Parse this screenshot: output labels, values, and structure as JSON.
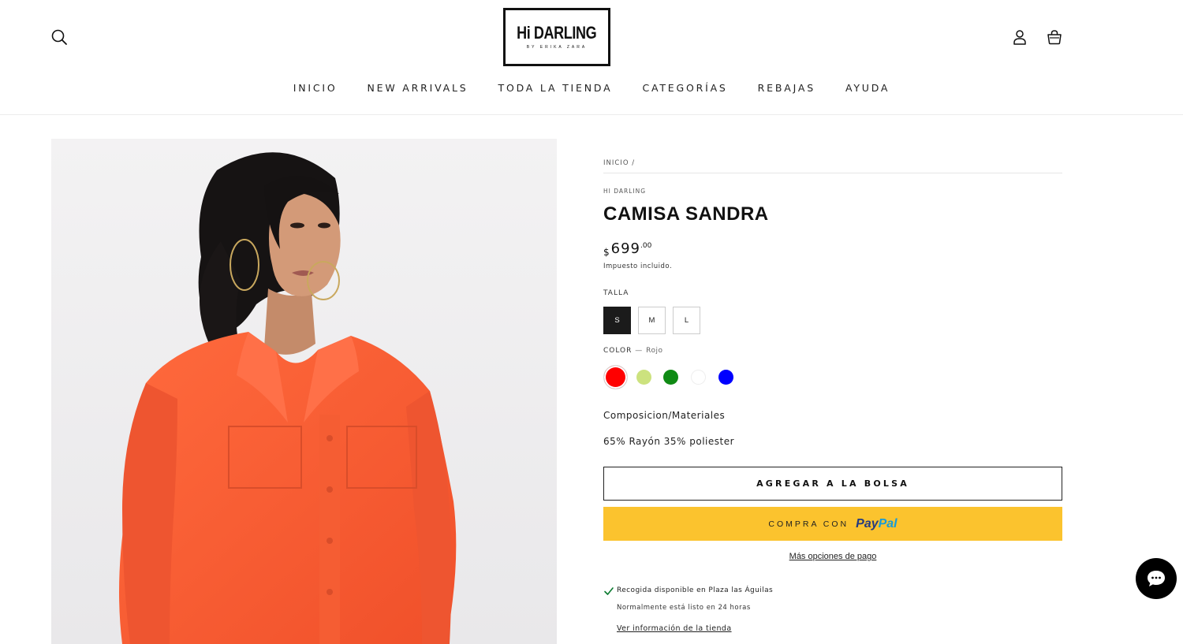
{
  "header": {
    "logo": {
      "main": "Hi DARLING",
      "sub": "BY ERIKA ZARA"
    },
    "icons": {
      "search": "search-icon",
      "account": "user-icon",
      "bag": "shopping-bag-icon"
    }
  },
  "nav": {
    "items": [
      "INICIO",
      "NEW ARRIVALS",
      "TODA LA TIENDA",
      "CATEGORÍAS",
      "REBAJAS",
      "AYUDA"
    ]
  },
  "product": {
    "breadcrumb": {
      "home": "INICIO",
      "separator": "/"
    },
    "vendor": "HI DARLING",
    "title": "CAMISA SANDRA",
    "price": {
      "currency": "$",
      "integer": "699",
      "decimals": ".00"
    },
    "tax_note": "Impuesto incluido.",
    "size": {
      "label": "TALLA",
      "options": [
        "S",
        "M",
        "L"
      ],
      "selected": "S"
    },
    "color": {
      "label": "COLOR",
      "separator": "—",
      "selected": "Rojo",
      "swatches": [
        {
          "name": "Rojo",
          "hex": "#ff0000"
        },
        {
          "name": "Verde claro",
          "hex": "#cce27e"
        },
        {
          "name": "Verde",
          "hex": "#0f8a14"
        },
        {
          "name": "Blanco",
          "hex": "#ffffff"
        },
        {
          "name": "Azul",
          "hex": "#0000ff"
        }
      ]
    },
    "composition_title": "Composicion/Materiales",
    "composition_value": "65% Rayón 35% poliester",
    "add_to_bag": "AGREGAR A LA BOLSA",
    "paypal": {
      "prefix": "COMPRA CON",
      "brand_a": "Pay",
      "brand_b": "Pal",
      "color": "#fbc32e"
    },
    "more_payment": "Más opciones de pago",
    "pickup": {
      "available": "Recogida disponible en Plaza las Águilas",
      "ready": "Normalmente está listo en 24 horas",
      "store_link": "Ver información de la tienda"
    }
  },
  "chat": {
    "icon": "chat-icon"
  }
}
